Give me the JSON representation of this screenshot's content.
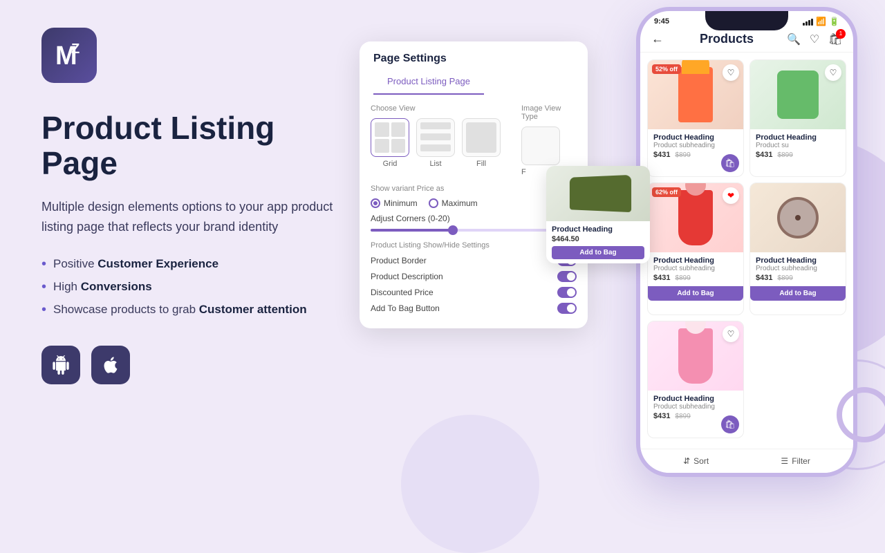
{
  "logo": {
    "alt": "MZ Logo"
  },
  "left": {
    "title_line1": "Product Listing",
    "title_line2": "Page",
    "description": "Multiple design elements options to your app product listing page that reflects your brand identity",
    "bullets": [
      {
        "prefix": "Positive ",
        "bold": "Customer Experience"
      },
      {
        "prefix": "High ",
        "bold": "Conversions"
      },
      {
        "prefix": "Showcase products to grab ",
        "bold": "Customer attention"
      }
    ],
    "platforms": {
      "android_label": "Android",
      "ios_label": "iOS"
    }
  },
  "settings_panel": {
    "title": "Page Settings",
    "tab": "Product Listing Page",
    "choose_view_label": "Choose View",
    "image_view_type_label": "Image View Type",
    "views": [
      {
        "name": "Grid",
        "selected": true
      },
      {
        "name": "List",
        "selected": false
      },
      {
        "name": "Fill",
        "selected": false
      },
      {
        "name": "F",
        "selected": false
      }
    ],
    "show_variant_label": "Show variant Price as",
    "minimum_label": "Minimum",
    "maximum_label": "Maximum",
    "corners_label": "Adjust Corners (0-20)",
    "show_hide_label": "Product Listing Show/Hide Settings",
    "toggles": [
      {
        "label": "Product Border",
        "on": true
      },
      {
        "label": "Product Description",
        "on": true
      },
      {
        "label": "Discounted Price",
        "on": true
      },
      {
        "label": "Add To Bag Button",
        "on": true
      }
    ]
  },
  "phone": {
    "time": "9:45",
    "title": "Products",
    "products": [
      {
        "name": "Product Heading",
        "sub": "Product subheading",
        "price": "$431",
        "old_price": "$899",
        "discount": "52% off",
        "img_class": "kid-outfit"
      },
      {
        "name": "Product Heading",
        "sub": "Product su",
        "price": "$431",
        "old_price": "$899",
        "img_class": "kid-hat"
      },
      {
        "name": "Product Heading",
        "sub": "Product subheading",
        "price": "$431",
        "old_price": "$899",
        "discount": "62% off",
        "img_class": "girl-dress",
        "show_add": true
      },
      {
        "name": "Product Heading",
        "sub": "Product subheading",
        "price": "$431",
        "old_price": "$899",
        "img_class": "watch-img",
        "show_add": true
      },
      {
        "name": "Product Heading",
        "sub": "Product subheading",
        "price": "$431",
        "old_price": "$899",
        "img_class": "pink-dress"
      }
    ],
    "floating_card": {
      "name": "Product Heading",
      "price": "$464.50",
      "btn": "Add to Bag",
      "img_class": "shoe-img"
    },
    "sort_label": "Sort",
    "filter_label": "Filter"
  },
  "colors": {
    "purple": "#7c5cbf",
    "dark_navy": "#1a2340"
  }
}
